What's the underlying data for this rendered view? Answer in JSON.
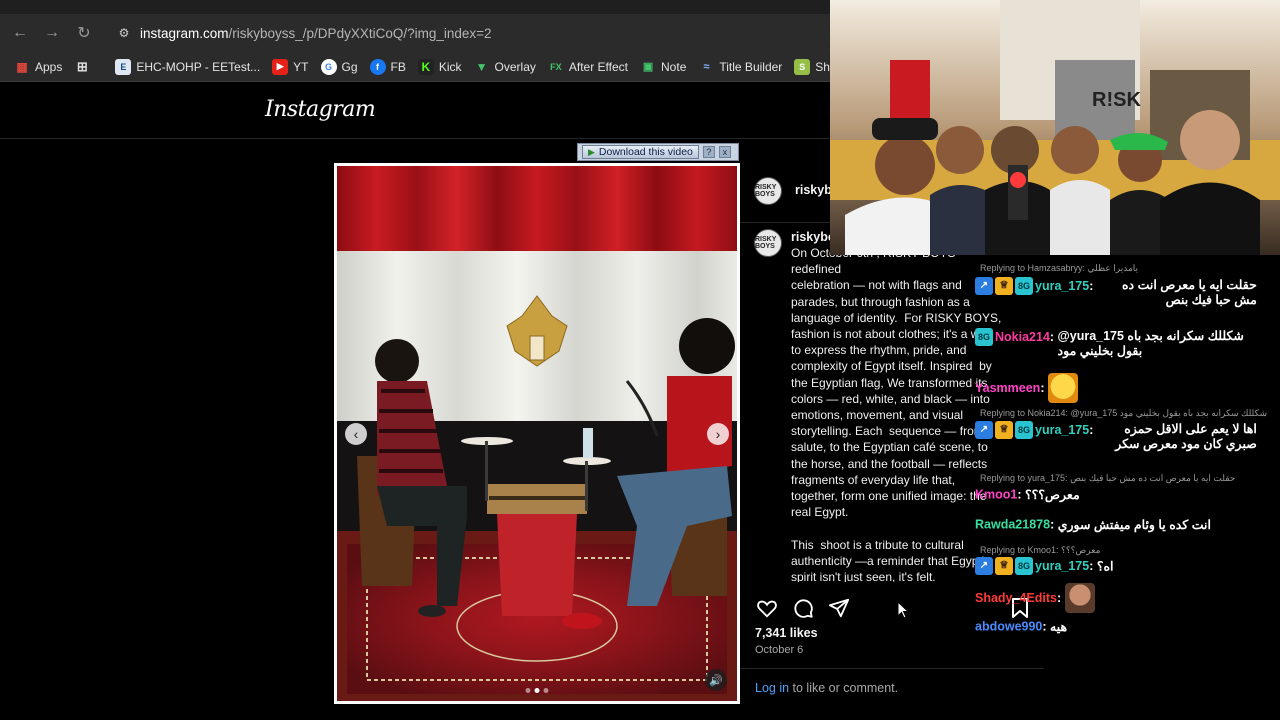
{
  "browser": {
    "url_host": "instagram.com",
    "url_path": "/riskyboyss_/p/DPdyXXtiCoQ/?img_index=2",
    "bookmarks": [
      {
        "label": "Apps",
        "icon": "apps-grid-icon"
      },
      {
        "label": "",
        "icon": "tab-groups-icon"
      },
      {
        "label": "EHC-MOHP - EETest...",
        "icon": "ehc-icon"
      },
      {
        "label": "YT",
        "icon": "youtube-icon"
      },
      {
        "label": "Gg",
        "icon": "google-icon"
      },
      {
        "label": "FB",
        "icon": "facebook-icon"
      },
      {
        "label": "Kick",
        "icon": "kick-icon"
      },
      {
        "label": "Overlay",
        "icon": "overlay-icon"
      },
      {
        "label": "After Effect",
        "icon": "fx-icon"
      },
      {
        "label": "Note",
        "icon": "note-icon"
      },
      {
        "label": "Title Builder",
        "icon": "title-builder-icon"
      },
      {
        "label": "Shopify",
        "icon": "shopify-icon"
      }
    ]
  },
  "instagram": {
    "logo": "Instagram",
    "download": {
      "label": "Download this video",
      "help": "?",
      "close": "x"
    },
    "post": {
      "avatar_text": "RISKY BOYS",
      "username_header": "riskyb",
      "username_caption": "riskybo",
      "caption": "On October 6th , RISKY BOYS  redefined\ncelebration — not with flags and\nparades, but through fashion as a\nlanguage of identity.  For RISKY BOYS,\nfashion is not about clothes; it's a way\nto express the rhythm, pride, and\ncomplexity of Egypt itself. Inspired  by\nthe Egyptian flag, We transformed its\ncolors — red, white, and black — into\nemotions, movement, and visual\nstorytelling. Each  sequence — from\nsalute, to the Egyptian café scene, to\nthe horse, and the football — reflects\nfragments of everyday life that,\ntogether, form one unified image: the\nreal Egypt.\n\nThis  shoot is a tribute to cultural\nauthenticity —a reminder that Egypt's\nspirit isn't just seen, it's felt.\nRisky Boys — raising fashion under the",
      "likes": "7,341 likes",
      "date": "October 6",
      "login_link": "Log in",
      "login_rest": " to like or comment."
    }
  },
  "chat": {
    "messages": [
      {
        "reply_to": "Replying to Hamzasabryy: يامديرا عظلي",
        "badges": true,
        "user": "yura_175",
        "color": "#2fd0c0",
        "text": "حقلت ايه يا معرص انت ده مش حبا فيك بنص"
      },
      {
        "reply_to": "",
        "badges": "one",
        "user": "Nokia214",
        "color": "#ff3aa0",
        "text": "@yura_175 شكللك سكرانه بجد باه بقول بخليني مود"
      },
      {
        "reply_to": "",
        "badges": false,
        "user": "Yasmmeen",
        "color": "#ff44c8",
        "text": "",
        "emote": "happy-emote"
      },
      {
        "reply_to": "Replying to Nokia214: @yura_175 شكللك سكرانه بجد باه بقول بخليني مود",
        "badges": true,
        "user": "yura_175",
        "color": "#2fd0c0",
        "text": "اها لا يعم على الاقل حمزه صبري كان مود معرص سكر"
      },
      {
        "reply_to": "Replying to yura_175: حقلت ايه يا معرص انت ده مش حبا فيك بنص",
        "badges": false,
        "user": "Kmoo1",
        "color": "#ff44c8",
        "text": "معرص؟؟؟"
      },
      {
        "reply_to": "",
        "badges": false,
        "user": "Rawda21878",
        "color": "#38e0a0",
        "text": "انت كده يا وئام ميفتش سوري"
      },
      {
        "reply_to": "Replying to Kmoo1: معرص؟؟؟",
        "badges": true,
        "user": "yura_175",
        "color": "#2fd0c0",
        "text": "اه؟"
      },
      {
        "reply_to": "",
        "badges": false,
        "user": "Shady_4Edits",
        "color": "#ff3a3a",
        "text": "",
        "emote": "face-emote"
      },
      {
        "reply_to": "",
        "badges": false,
        "user": "abdowe990",
        "color": "#4a8cff",
        "text": "هيه"
      }
    ]
  },
  "colors": {
    "ig_link": "#4aa3f5",
    "chat_teal": "#2fd0c0"
  }
}
